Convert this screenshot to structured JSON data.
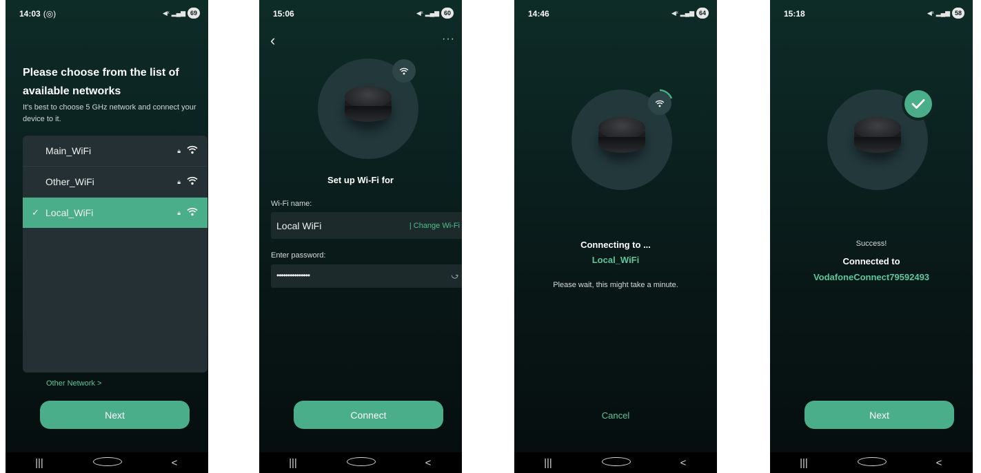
{
  "colors": {
    "accent": "#4bae8a",
    "accent_text": "#5cc79c",
    "bg_dark": "#0b2220",
    "list_bg": "#243033"
  },
  "navbar": {
    "recents": "|||",
    "back": "<"
  },
  "screen1": {
    "status": {
      "time": "14:03",
      "extra": "(◎)",
      "battery": "69"
    },
    "title": "Please choose from the list of available networks",
    "description": "It's best to choose 5 GHz network and connect your device to it.",
    "networks": [
      {
        "name": "Main_WiFi",
        "selected": false
      },
      {
        "name": "Other_WiFi",
        "selected": false
      },
      {
        "name": "Local_WiFi",
        "selected": true
      }
    ],
    "check_glyph": "✓",
    "other_network": "Other Network >",
    "next": "Next"
  },
  "screen2": {
    "status": {
      "time": "15:06",
      "battery": "60"
    },
    "title": "Set up Wi-Fi for",
    "wifi_name_label": "Wi-Fi name:",
    "wifi_name_value": "Local  WiFi",
    "change_wifi": "| Change Wi-Fi",
    "password_label": "Enter password:",
    "password_value": "•••••••••••••••",
    "connect": "Connect"
  },
  "screen3": {
    "status": {
      "time": "14:46",
      "battery": "64"
    },
    "connecting": "Connecting to ...",
    "ssid": "Local_WiFi",
    "wait": "Please wait, this might take a minute.",
    "cancel": "Cancel"
  },
  "screen4": {
    "status": {
      "time": "15:18",
      "battery": "58"
    },
    "success": "Success!",
    "connected_to": "Connected to",
    "ssid": "VodafoneConnect79592493",
    "next": "Next"
  }
}
